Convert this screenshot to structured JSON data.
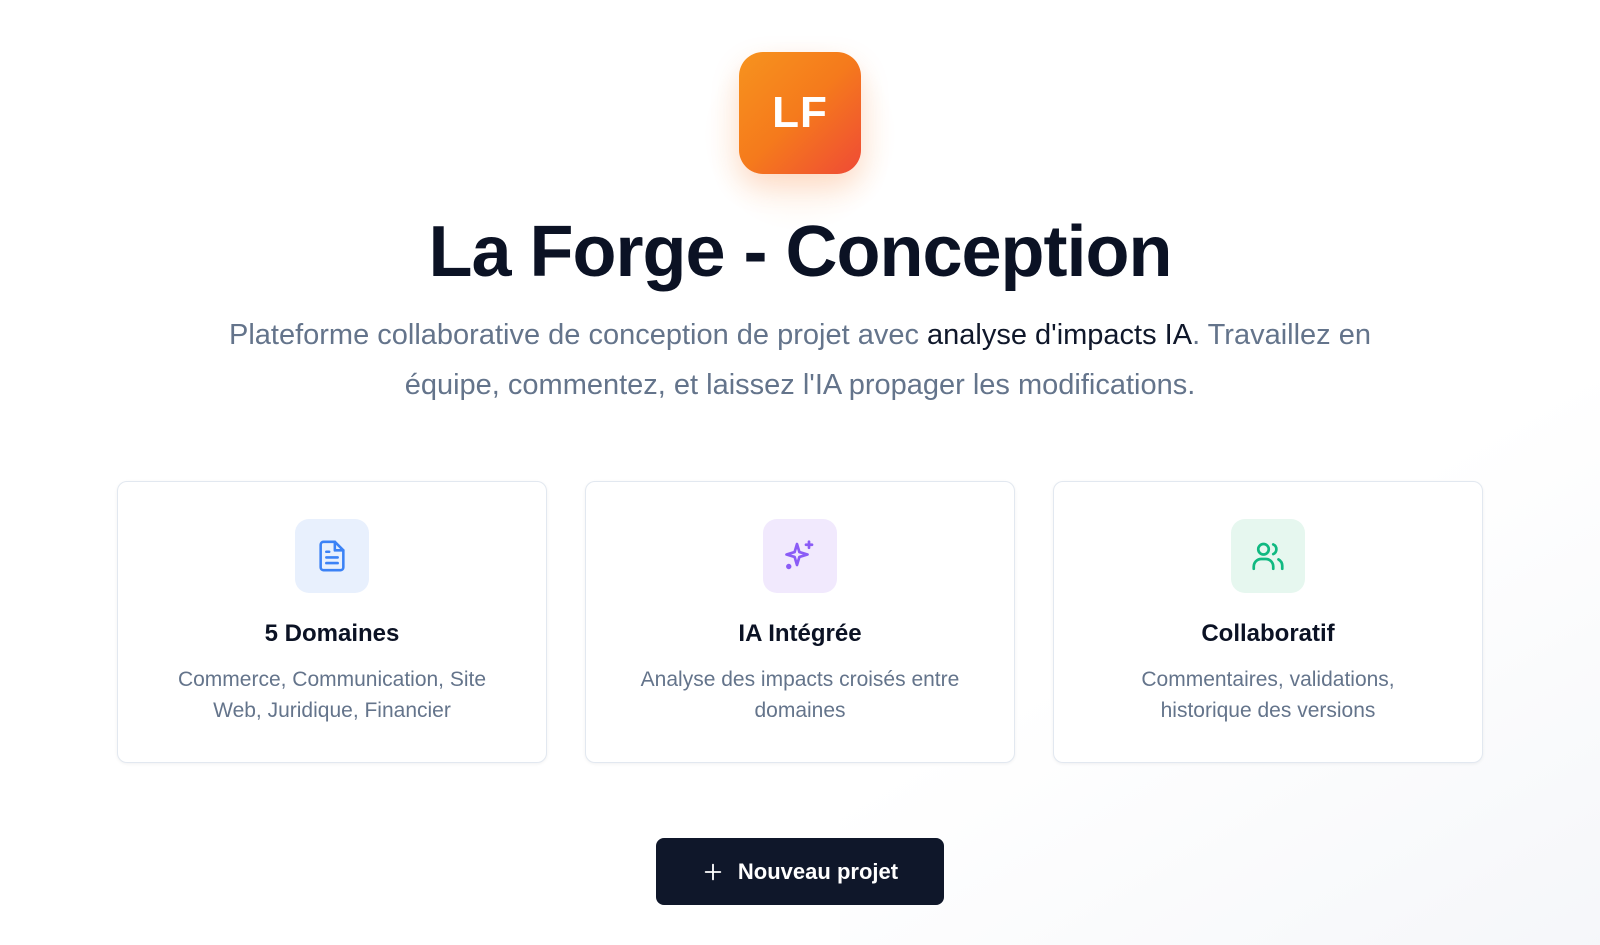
{
  "logo": {
    "text": "LF",
    "gradient_start": "#f7931e",
    "gradient_end": "#ef4a36"
  },
  "header": {
    "title": "La Forge - Conception",
    "subtitle_part1": "Plateforme collaborative de conception de projet avec ",
    "subtitle_strong": "analyse d'impacts IA",
    "subtitle_part2": ". Travaillez en équipe, commentez, et laissez l'IA propager les modifications."
  },
  "features": [
    {
      "icon": "document-icon",
      "icon_color": "#3b82f6",
      "title": "5 Domaines",
      "description": "Commerce, Communication, Site Web, Juridique, Financier"
    },
    {
      "icon": "sparkles-icon",
      "icon_color": "#8b5cf6",
      "title": "IA Intégrée",
      "description": "Analyse des impacts croisés entre domaines"
    },
    {
      "icon": "users-icon",
      "icon_color": "#10b981",
      "title": "Collaboratif",
      "description": "Commentaires, validations, historique des versions"
    }
  ],
  "cta": {
    "icon": "plus-icon",
    "label": "Nouveau projet"
  },
  "colors": {
    "primary_dark": "#0f172a",
    "muted_text": "#64748b"
  }
}
